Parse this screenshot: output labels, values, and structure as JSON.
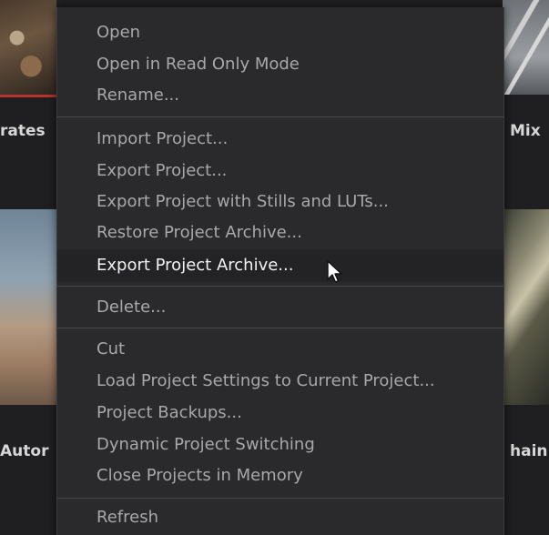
{
  "background": {
    "project_titles": {
      "row1_left": "rates",
      "row1_right": "Mix",
      "row2_left": "Autor",
      "row2_right": "hain"
    }
  },
  "context_menu": {
    "groups": [
      [
        "Open",
        "Open in Read Only Mode",
        "Rename..."
      ],
      [
        "Import Project...",
        "Export Project...",
        "Export Project with Stills and LUTs...",
        "Restore Project Archive...",
        "Export Project Archive..."
      ],
      [
        "Delete..."
      ],
      [
        "Cut",
        "Load Project Settings to Current Project...",
        "Project Backups...",
        "Dynamic Project Switching",
        "Close Projects in Memory"
      ],
      [
        "Refresh"
      ]
    ],
    "hovered_item": "Export Project Archive...",
    "colors": {
      "menu_bg": "#2a2a2d",
      "item_text": "#a8a8ab",
      "hover_bg": "#232325",
      "hover_text": "#f2f2f2"
    }
  },
  "icons": {
    "mouse_cursor": "arrow-cursor-icon"
  }
}
